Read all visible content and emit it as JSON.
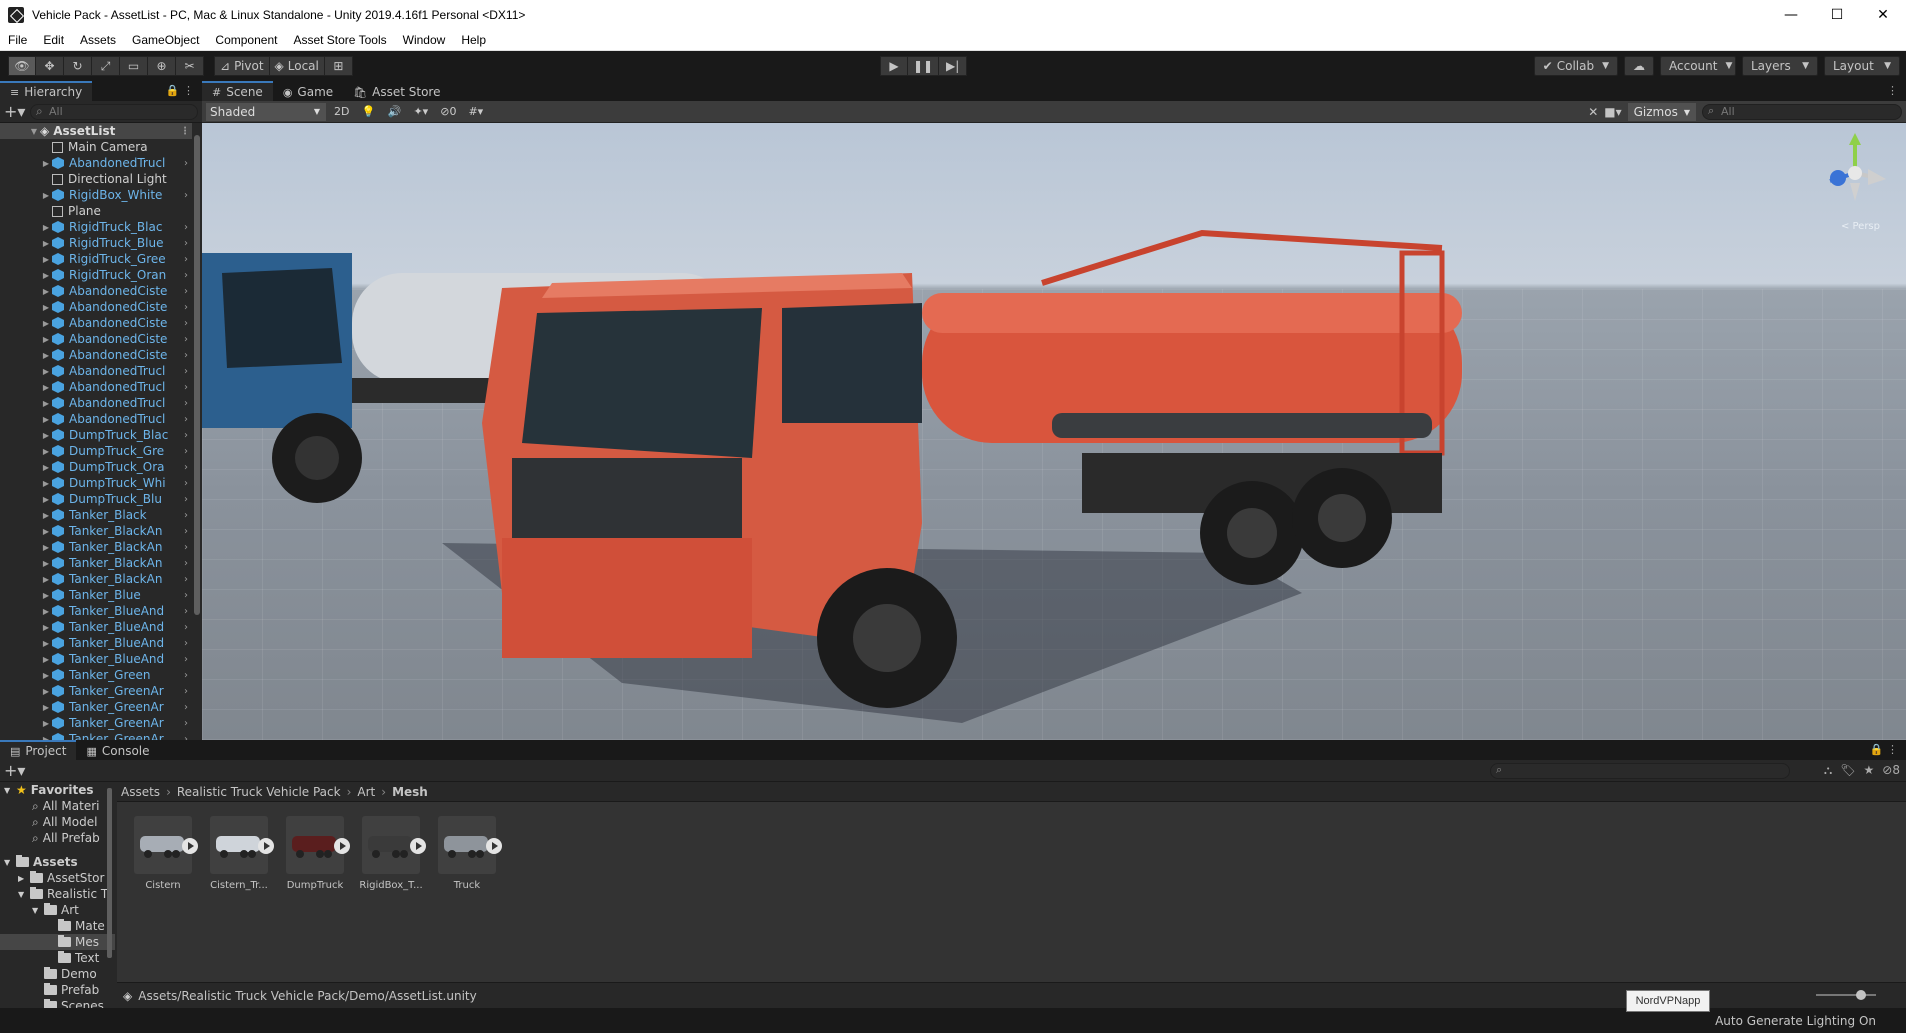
{
  "window": {
    "title": "Vehicle Pack - AssetList - PC, Mac & Linux Standalone - Unity 2019.4.16f1 Personal <DX11>",
    "minimize_icon": "minimize-icon",
    "maximize_icon": "maximize-icon",
    "close_icon": "close-icon"
  },
  "menu": [
    "File",
    "Edit",
    "Assets",
    "GameObject",
    "Component",
    "Asset Store Tools",
    "Window",
    "Help"
  ],
  "toolbar": {
    "pivot_label": "Pivot",
    "local_label": "Local",
    "collab_label": "Collab",
    "account_label": "Account",
    "layers_label": "Layers",
    "layout_label": "Layout"
  },
  "hierarchy": {
    "tab_label": "Hierarchy",
    "search_placeholder": "All",
    "root": "AssetList",
    "items": [
      {
        "label": "Main Camera",
        "type": "plain"
      },
      {
        "label": "AbandonedTrucl",
        "type": "prefab"
      },
      {
        "label": "Directional Light",
        "type": "plain"
      },
      {
        "label": "RigidBox_White",
        "type": "prefab"
      },
      {
        "label": "Plane",
        "type": "plain"
      },
      {
        "label": "RigidTruck_Blac",
        "type": "prefab"
      },
      {
        "label": "RigidTruck_Blue",
        "type": "prefab"
      },
      {
        "label": "RigidTruck_Gree",
        "type": "prefab"
      },
      {
        "label": "RigidTruck_Oran",
        "type": "prefab"
      },
      {
        "label": "AbandonedCiste",
        "type": "prefab"
      },
      {
        "label": "AbandonedCiste",
        "type": "prefab"
      },
      {
        "label": "AbandonedCiste",
        "type": "prefab"
      },
      {
        "label": "AbandonedCiste",
        "type": "prefab"
      },
      {
        "label": "AbandonedCiste",
        "type": "prefab"
      },
      {
        "label": "AbandonedTrucl",
        "type": "prefab"
      },
      {
        "label": "AbandonedTrucl",
        "type": "prefab"
      },
      {
        "label": "AbandonedTrucl",
        "type": "prefab"
      },
      {
        "label": "AbandonedTrucl",
        "type": "prefab"
      },
      {
        "label": "DumpTruck_Blac",
        "type": "prefab"
      },
      {
        "label": "DumpTruck_Gre",
        "type": "prefab"
      },
      {
        "label": "DumpTruck_Ora",
        "type": "prefab"
      },
      {
        "label": "DumpTruck_Whi",
        "type": "prefab"
      },
      {
        "label": "DumpTruck_Blu",
        "type": "prefab"
      },
      {
        "label": "Tanker_Black",
        "type": "prefab"
      },
      {
        "label": "Tanker_BlackAn",
        "type": "prefab"
      },
      {
        "label": "Tanker_BlackAn",
        "type": "prefab"
      },
      {
        "label": "Tanker_BlackAn",
        "type": "prefab"
      },
      {
        "label": "Tanker_BlackAn",
        "type": "prefab"
      },
      {
        "label": "Tanker_Blue",
        "type": "prefab"
      },
      {
        "label": "Tanker_BlueAnd",
        "type": "prefab"
      },
      {
        "label": "Tanker_BlueAnd",
        "type": "prefab"
      },
      {
        "label": "Tanker_BlueAnd",
        "type": "prefab"
      },
      {
        "label": "Tanker_BlueAnd",
        "type": "prefab"
      },
      {
        "label": "Tanker_Green",
        "type": "prefab"
      },
      {
        "label": "Tanker_GreenAr",
        "type": "prefab"
      },
      {
        "label": "Tanker_GreenAr",
        "type": "prefab"
      },
      {
        "label": "Tanker_GreenAr",
        "type": "prefab"
      },
      {
        "label": "Tanker_GreenAr",
        "type": "prefab"
      }
    ]
  },
  "scene": {
    "tabs": [
      {
        "label": "Scene",
        "icon": "grid-icon"
      },
      {
        "label": "Game",
        "icon": "gamepad-icon"
      },
      {
        "label": "Asset Store",
        "icon": "store-icon"
      }
    ],
    "shading_mode": "Shaded",
    "btn_2d": "2D",
    "hidden_count": "0",
    "gizmos_label": "Gizmos",
    "search_placeholder": "All",
    "persp_label": "< Persp"
  },
  "project": {
    "tabs": [
      {
        "label": "Project",
        "icon": "folder-icon"
      },
      {
        "label": "Console",
        "icon": "console-icon"
      }
    ],
    "favorites": {
      "label": "Favorites",
      "items": [
        "All Materi",
        "All Model",
        "All Prefab"
      ]
    },
    "assets_tree": [
      {
        "label": "Assets",
        "depth": 0,
        "bold": true
      },
      {
        "label": "AssetStor",
        "depth": 1
      },
      {
        "label": "Realistic T",
        "depth": 1
      },
      {
        "label": "Art",
        "depth": 2
      },
      {
        "label": "Mate",
        "depth": 3
      },
      {
        "label": "Mes",
        "depth": 3,
        "selected": true
      },
      {
        "label": "Text",
        "depth": 3
      },
      {
        "label": "Demo",
        "depth": 2
      },
      {
        "label": "Prefab",
        "depth": 2
      },
      {
        "label": "Scenes",
        "depth": 2
      }
    ],
    "breadcrumbs": [
      "Assets",
      "Realistic Truck Vehicle Pack",
      "Art",
      "Mesh"
    ],
    "assets": [
      {
        "name": "Cistern",
        "color": "#a7adb5"
      },
      {
        "name": "Cistern_Tr...",
        "color": "#cfd4da"
      },
      {
        "name": "DumpTruck",
        "color": "#5a1e1e"
      },
      {
        "name": "RigidBox_T...",
        "color": "#3a3a3a"
      },
      {
        "name": "Truck",
        "color": "#8e949b"
      }
    ],
    "path": "Assets/Realistic Truck Vehicle Pack/Demo/AssetList.unity",
    "hidden_count": "8"
  },
  "status": {
    "tooltip": "NordVPNapp",
    "text": "Auto Generate Lighting On"
  }
}
